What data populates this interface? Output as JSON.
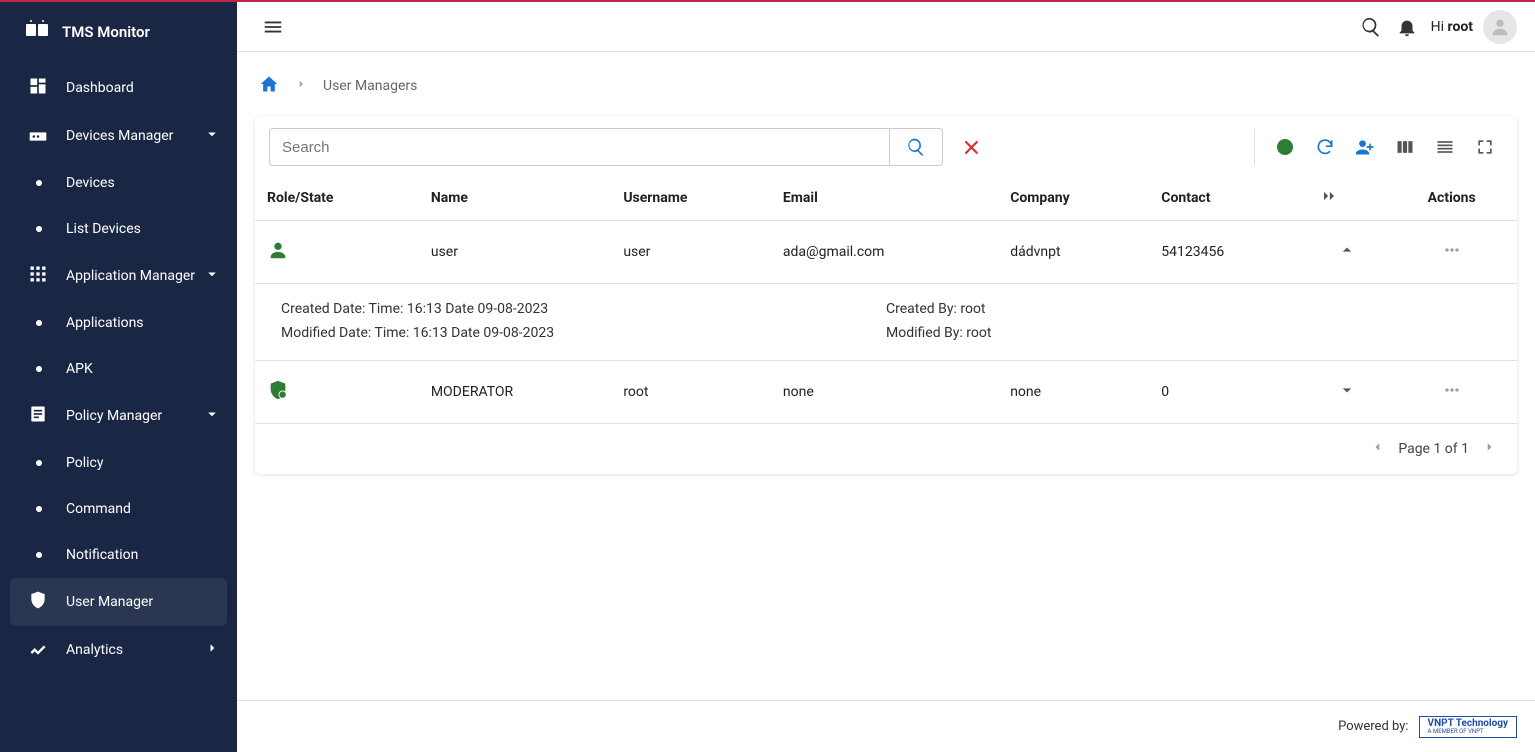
{
  "app": {
    "name": "TMS Monitor"
  },
  "header": {
    "greeting_prefix": "Hi ",
    "greeting_user": "root"
  },
  "breadcrumb": {
    "current": "User Managers"
  },
  "search": {
    "placeholder": "Search"
  },
  "sidebar": {
    "items": [
      {
        "label": "Dashboard"
      },
      {
        "label": "Devices Manager",
        "children": [
          {
            "label": "Devices"
          },
          {
            "label": "List Devices"
          }
        ]
      },
      {
        "label": "Application Manager",
        "children": [
          {
            "label": "Applications"
          },
          {
            "label": "APK"
          }
        ]
      },
      {
        "label": "Policy Manager",
        "children": [
          {
            "label": "Policy"
          },
          {
            "label": "Command"
          },
          {
            "label": "Notification"
          }
        ]
      },
      {
        "label": "User Manager"
      },
      {
        "label": "Analytics"
      }
    ]
  },
  "table": {
    "headers": {
      "role": "Role/State",
      "name": "Name",
      "username": "Username",
      "email": "Email",
      "company": "Company",
      "contact": "Contact",
      "actions": "Actions"
    },
    "rows": [
      {
        "role": "user",
        "name": "user",
        "username": "user",
        "email": "ada@gmail.com",
        "company": "dádvnpt",
        "contact": "54123456",
        "expanded": true,
        "detail": {
          "created_date_label": "Created Date:",
          "created_date_value": "Time: 16:13 Date 09-08-2023",
          "modified_date_label": "Modified Date:",
          "modified_date_value": "Time: 16:13 Date 09-08-2023",
          "created_by_label": "Created By:",
          "created_by_value": "root",
          "modified_by_label": "Modified By:",
          "modified_by_value": "root"
        }
      },
      {
        "role": "moderator",
        "name": "MODERATOR",
        "username": "root",
        "email": "none",
        "company": "none",
        "contact": "0",
        "expanded": false
      }
    ]
  },
  "pager": {
    "text": "Page 1 of 1"
  },
  "footer": {
    "text": "Powered by:",
    "logo_main": "VNPT Technology",
    "logo_sub": "A MEMBER OF VNPT"
  }
}
